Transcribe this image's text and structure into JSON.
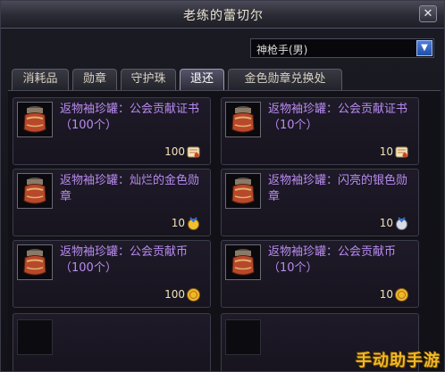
{
  "window": {
    "title": "老练的蕾切尔",
    "close_symbol": "✕"
  },
  "class_select": {
    "value": "神枪手(男)"
  },
  "tabs": [
    {
      "label": "消耗品",
      "active": false
    },
    {
      "label": "勋章",
      "active": false
    },
    {
      "label": "守护珠",
      "active": false
    },
    {
      "label": "退还",
      "active": true
    },
    {
      "label": "金色勋章兑换处",
      "active": false
    }
  ],
  "items": [
    {
      "name": "返物袖珍罐：公会贡献证书（100个）",
      "price": "100",
      "currency": "scroll"
    },
    {
      "name": "返物袖珍罐：公会贡献证书（10个）",
      "price": "10",
      "currency": "scroll"
    },
    {
      "name": "返物袖珍罐：灿烂的金色勋章",
      "price": "10",
      "currency": "gold-medal"
    },
    {
      "name": "返物袖珍罐：闪亮的银色勋章",
      "price": "10",
      "currency": "silver-medal"
    },
    {
      "name": "返物袖珍罐：公会贡献币（100个）",
      "price": "100",
      "currency": "coin"
    },
    {
      "name": "返物袖珍罐：公会贡献币（10个）",
      "price": "10",
      "currency": "coin"
    }
  ],
  "watermark": "手动助手游",
  "colors": {
    "item_name": "#b98cf0",
    "accent_blue": "#2a5cc0",
    "gold": "#e8b020"
  }
}
